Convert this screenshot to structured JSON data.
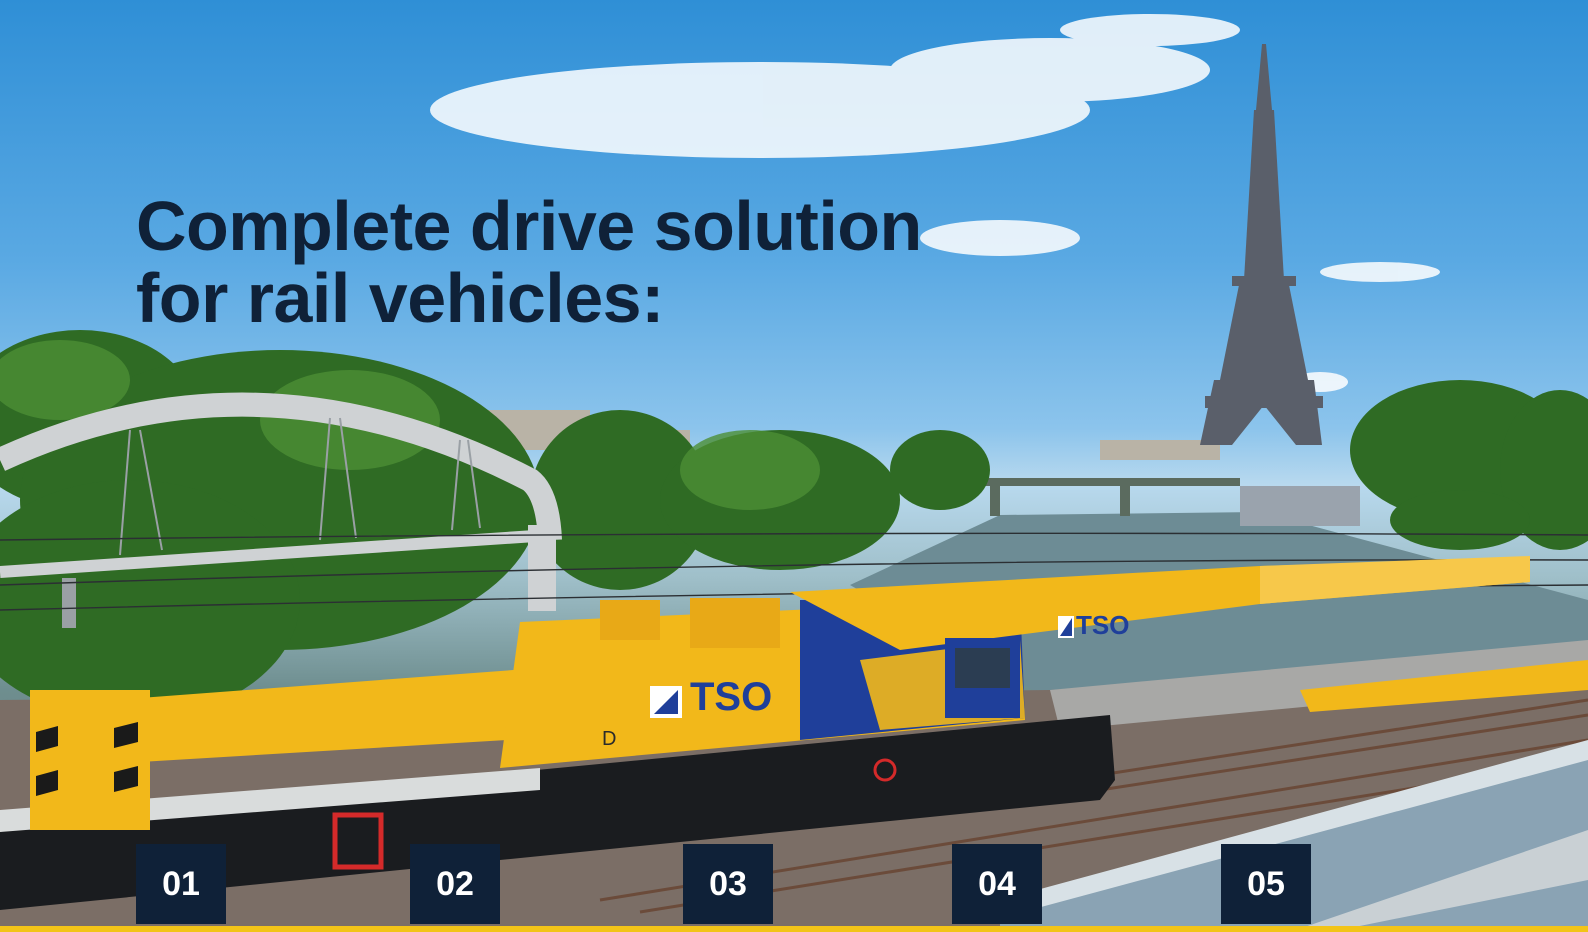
{
  "hero": {
    "headline_line1": "Complete drive solution",
    "headline_line2": "for rail vehicles:",
    "crane_brand": "TSO",
    "crane_marker": "D"
  },
  "tabs": [
    {
      "label": "01"
    },
    {
      "label": "02"
    },
    {
      "label": "03"
    },
    {
      "label": "04"
    },
    {
      "label": "05"
    }
  ],
  "colors": {
    "navy": "#0f2138",
    "crane_yellow": "#f2b81a",
    "tso_blue": "#1f3f9a",
    "accent_yellow": "#f2c418"
  }
}
